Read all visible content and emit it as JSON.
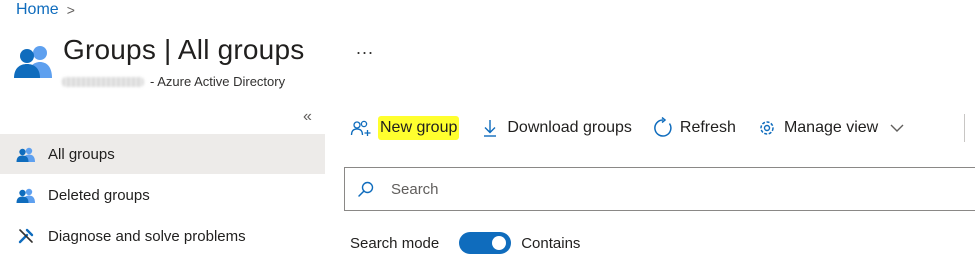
{
  "breadcrumb": {
    "home": "Home",
    "separator": ">"
  },
  "header": {
    "title": "Groups | All groups",
    "more": "...",
    "subtitle": "- Azure Active Directory",
    "icon": "groups-icon"
  },
  "sidebar": {
    "collapse": "«",
    "items": [
      {
        "label": "All groups",
        "icon": "groups-icon",
        "active": true
      },
      {
        "label": "Deleted groups",
        "icon": "groups-icon",
        "active": false
      },
      {
        "label": "Diagnose and solve problems",
        "icon": "wrench-icon",
        "active": false
      }
    ]
  },
  "toolbar": {
    "new_group": "New group",
    "download_groups": "Download groups",
    "refresh": "Refresh",
    "manage_view": "Manage view"
  },
  "search": {
    "placeholder": "Search",
    "value": ""
  },
  "search_mode": {
    "label": "Search mode",
    "value": "Contains",
    "enabled": true
  },
  "colors": {
    "accent": "#0f6cbd",
    "highlight": "#ffff2e",
    "active_nav": "#edebe9"
  }
}
